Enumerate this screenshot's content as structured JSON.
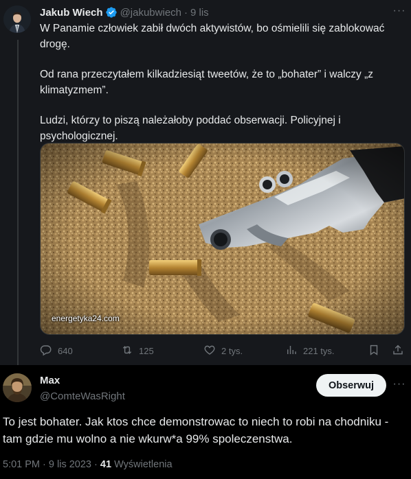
{
  "quoted_tweet": {
    "author_name": "Jakub Wiech",
    "handle": "@jakubwiech",
    "separator": "·",
    "time": "9 lis",
    "more_glyph": "···",
    "paragraphs": [
      "W Panamie człowiek zabił dwóch aktywistów, bo ośmielili się zablokować drogę.",
      "Od rana przeczytałem kilkadziesiąt tweetów, że to „bohater” i walczy „z klimatyzmem”.",
      "Ludzi, którzy to piszą należałoby poddać obserwacji. Policyjnej i psychologicznej."
    ],
    "media_watermark": "energetyka24.com",
    "actions": {
      "replies": "640",
      "retweets": "125",
      "likes": "2 tys.",
      "views": "221 tys."
    },
    "icons": [
      "verified-badge-icon",
      "reply-icon",
      "retweet-icon",
      "like-icon",
      "views-icon",
      "bookmark-icon",
      "share-icon"
    ],
    "colors": {
      "verified": "#1d9bf0",
      "background": "#16181c"
    }
  },
  "reply_tweet": {
    "author_name": "Max",
    "handle": "@ComteWasRight",
    "follow_label": "Obserwuj",
    "more_glyph": "···",
    "text": "To jest bohater. Jak ktos chce demonstrowac to niech to robi na chodniku - tam gdzie mu wolno a nie wkurw*a 99% spoleczenstwa.",
    "time": "5:01 PM",
    "separator": "·",
    "date": "9 lis 2023",
    "views_count": "41",
    "views_label": "Wyświetlenia",
    "colors": {
      "background": "#000000",
      "follow_button": "#eff3f4"
    }
  }
}
